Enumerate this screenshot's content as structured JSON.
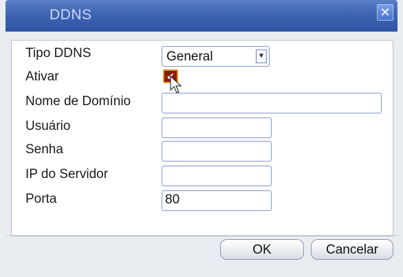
{
  "window": {
    "title": "DDNS",
    "close_glyph": "✕"
  },
  "form": {
    "tipo_ddns": {
      "label": "Tipo DDNS",
      "value": "General"
    },
    "ativar": {
      "label": "Ativar",
      "checked": true
    },
    "nome_dominio": {
      "label": "Nome de Domínio",
      "value": ""
    },
    "usuario": {
      "label": "Usuário",
      "value": ""
    },
    "senha": {
      "label": "Senha",
      "value": ""
    },
    "ip_servidor": {
      "label": "IP do Servidor",
      "value": ""
    },
    "porta": {
      "label": "Porta",
      "value": "80"
    }
  },
  "buttons": {
    "ok": "OK",
    "cancel": "Cancelar"
  },
  "colors": {
    "titlebar": "#3f64b3",
    "checkbox_fill": "#8b1a10",
    "checkbox_border": "#e39a1c",
    "field_border": "#7f95c9"
  }
}
